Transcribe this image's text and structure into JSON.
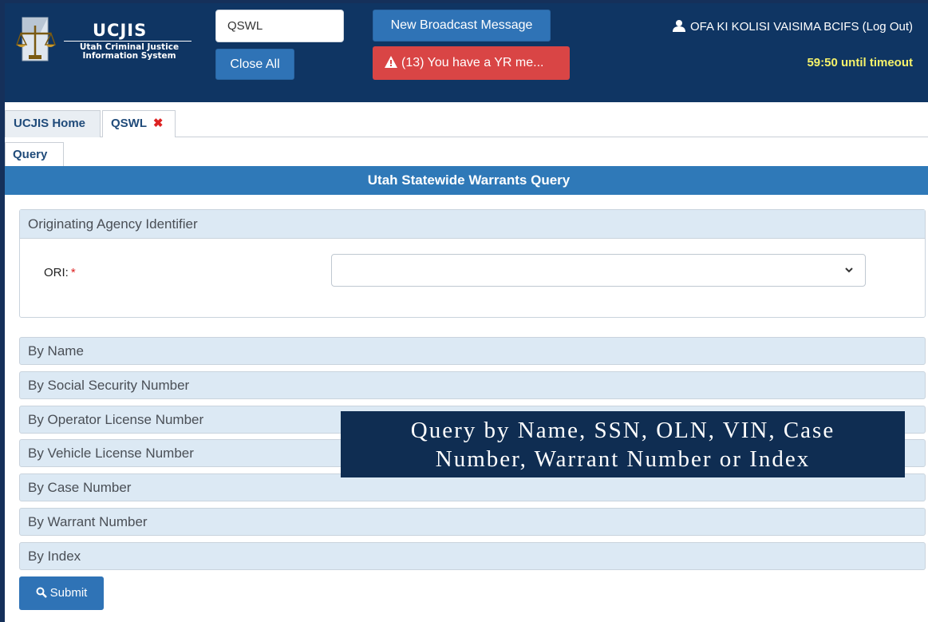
{
  "header": {
    "logo_title": "UCJIS",
    "logo_subtitle_1": "Utah Criminal Justice",
    "logo_subtitle_2": "Information System",
    "search_value": "QSWL",
    "close_all_label": "Close All",
    "broadcast_label": "New Broadcast Message",
    "alert_label": "(13) You have a YR me...",
    "user_label": "OFA KI KOLISI VAISIMA BCIFS (Log Out)",
    "timeout_label": "59:50 until timeout"
  },
  "tabs": [
    {
      "label": "UCJIS Home"
    },
    {
      "label": "QSWL",
      "close": "✖"
    }
  ],
  "subtabs": [
    {
      "label": "Query"
    }
  ],
  "page_title": "Utah Statewide Warrants Query",
  "oai_panel": {
    "title": "Originating Agency Identifier",
    "ori_label": "ORI:",
    "required_mark": "*",
    "ori_value": ""
  },
  "sections": [
    {
      "label": "By Name"
    },
    {
      "label": "By Social Security Number"
    },
    {
      "label": "By Operator License Number"
    },
    {
      "label": "By Vehicle License Number"
    },
    {
      "label": "By Case Number"
    },
    {
      "label": "By Warrant Number"
    },
    {
      "label": "By Index"
    }
  ],
  "submit_label": "Submit",
  "caption": {
    "line1": "Query by Name, SSN, OLN, VIN, Case",
    "line2": "Number, Warrant Number or Index"
  },
  "colors": {
    "header_bg": "#0f3563",
    "accent_blue": "#2f73b6",
    "alert_red": "#d94545",
    "timeout_yellow": "#f5f26a",
    "section_bg": "#dce9f4"
  },
  "icons": [
    "scales-of-justice-icon",
    "warning-triangle-icon",
    "user-icon",
    "close-icon",
    "chevron-down-icon",
    "search-icon"
  ]
}
